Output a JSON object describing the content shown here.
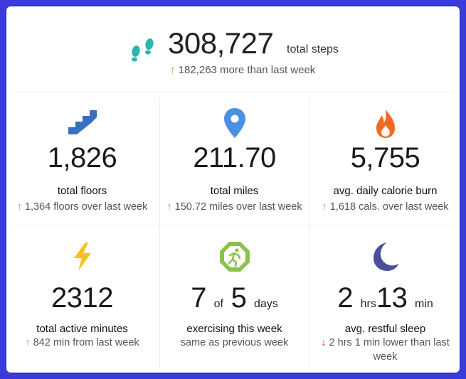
{
  "steps": {
    "value": "308,727",
    "label": "total steps",
    "change": "182,263 more than last week",
    "change_direction": "up"
  },
  "stats": [
    {
      "icon": "stairs-icon",
      "value": "1,826",
      "label": "total floors",
      "change": "1,364 floors over last week",
      "change_direction": "up"
    },
    {
      "icon": "location-pin-icon",
      "value": "211.70",
      "label": "total miles",
      "change": "150.72 miles over last week",
      "change_direction": "up"
    },
    {
      "icon": "flame-icon",
      "value": "5,755",
      "label": "avg. daily calorie burn",
      "change": "1,618 cals. over last week",
      "change_direction": "up"
    },
    {
      "icon": "lightning-bolt-icon",
      "value": "2312",
      "label": "total active minutes",
      "change": "842 min from last week",
      "change_direction": "up"
    },
    {
      "icon": "running-person-badge-icon",
      "value_main": "7",
      "value_of": "of",
      "value_total": "5",
      "value_unit": "days",
      "label": "exercising this week",
      "change": "same as previous week",
      "change_direction": "none"
    },
    {
      "icon": "moon-icon",
      "value_hrs": "2",
      "hrs_unit": "hrs",
      "value_min": "13",
      "min_unit": "min",
      "label": "avg. restful sleep",
      "change_line1": "2 hrs 1 min lower than last",
      "change_line2": "week",
      "change_direction": "down"
    }
  ],
  "colors": {
    "border": "#3b3bdc",
    "up_arrow": "#7cb342",
    "down_arrow": "#e53935",
    "steps_icon": "#2bb5b0",
    "stairs_icon": "#3a6fbf",
    "pin_icon": "#4a90e2",
    "flame_icon": "#f26a21",
    "bolt_icon": "#f7c21a",
    "badge_icon": "#8bc34a",
    "moon_icon": "#4a4f9c"
  },
  "arrows": {
    "up": "↑",
    "down": "↓"
  }
}
